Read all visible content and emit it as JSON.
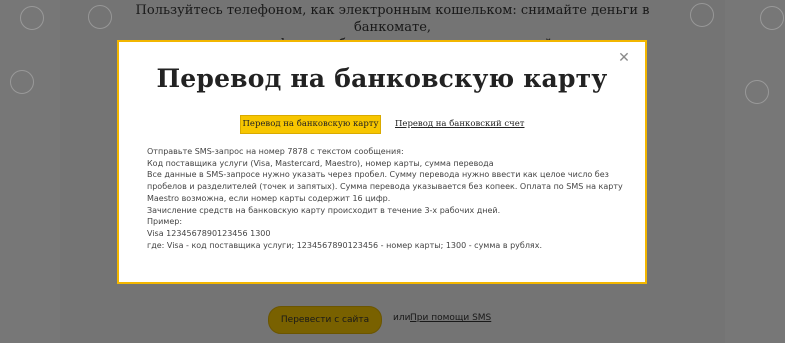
{
  "background": {
    "intro_line_1": "Пользуйтесь телефоном, как электронным кошельком: снимайте деньги в банкомате,",
    "intro_line_2": "переводите на телефон или банковскую карту и отправляйте переводы.",
    "send_from_site_button": "Перевести с сайта",
    "or_text": "или",
    "sms_link": "При помощи SMS"
  },
  "modal": {
    "close_icon": "close-icon",
    "title": "Перевод на банковскую карту",
    "tabs": {
      "active": "Перевод на банковскую карту",
      "other": "Перевод на банковский счет"
    },
    "body_lines": [
      "Отправьте SMS-запрос на номер 7878 с текстом сообщения:",
      "Код поставщика услуги (Visa, Mastercard, Maestro), номер карты, сумма перевода",
      "Все данные в SMS-запросе нужно указать через пробел. Сумму перевода нужно ввести как целое число без",
      "пробелов и разделителей (точек и запятых). Сумма перевода указывается без копеек. Оплата по SMS на карту",
      "Maestro возможна, если номер карты содержит 16 цифр.",
      "Зачисление средств на банковскую карту происходит в течение 3-х рабочих дней.",
      "Пример:",
      "Visa 1234567890123456 1300",
      "где: Visa - код поставщика услуги; 1234567890123456 - номер карты; 1300 - сумма в рублях."
    ]
  },
  "colors": {
    "accent": "#f7c600",
    "modal_border": "#f2b600",
    "overlay": "#7a7a7a"
  }
}
